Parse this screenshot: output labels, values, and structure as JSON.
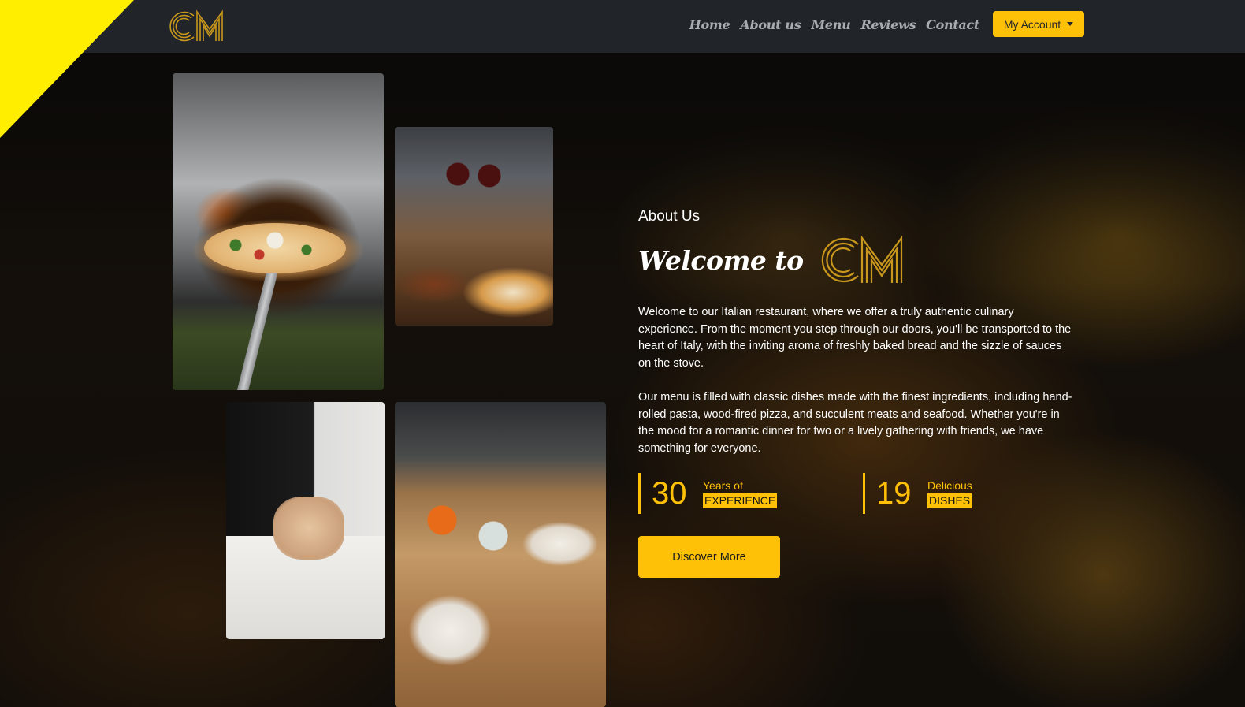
{
  "brand": {
    "logo_text": "CM"
  },
  "nav": {
    "links": [
      "Home",
      "About us",
      "Menu",
      "Reviews",
      "Contact"
    ],
    "account_label": "My Account"
  },
  "about": {
    "eyebrow": "About Us",
    "welcome": "Welcome to",
    "paragraph_1": "Welcome to our Italian restaurant, where we offer a truly authentic culinary experience. From the moment you step through our doors, you'll be transported to the heart of Italy, with the inviting aroma of freshly baked bread and the sizzle of sauces on the stove.",
    "paragraph_2": "Our menu is filled with classic dishes made with the finest ingredients, including hand-rolled pasta, wood-fired pizza, and succulent meats and seafood. Whether you're in the mood for a romantic dinner for two or a lively gathering with friends, we have something for everyone.",
    "stats": [
      {
        "number": "30",
        "top": "Years of",
        "bottom": "EXPERIENCE"
      },
      {
        "number": "19",
        "top": "Delicious",
        "bottom": "DISHES"
      }
    ],
    "cta_label": "Discover More"
  },
  "colors": {
    "accent": "#ffc107",
    "nav_bg": "#212429",
    "corner": "#ffee00"
  },
  "icons": {
    "account_caret": "caret-down-icon"
  }
}
